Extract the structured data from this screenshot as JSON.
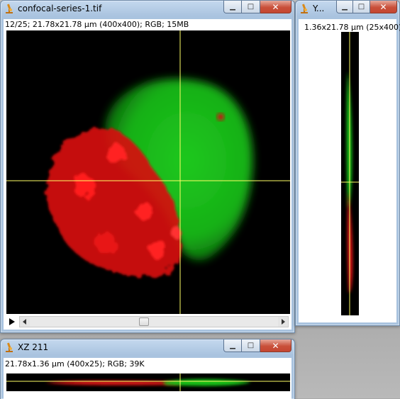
{
  "main_window": {
    "title": "confocal-series-1.tif",
    "info": "12/25; 21.78x21.78 µm (400x400); RGB; 15MB",
    "slice_current": 12,
    "slice_total": 25
  },
  "yz_window": {
    "title": "Y...",
    "info": "1.36x21.78 µm (25x400)"
  },
  "xz_window": {
    "title": "XZ 211",
    "info": "21.78x1.36 µm (400x25); RGB; 39K"
  },
  "colors": {
    "green_channel": "#00ff00",
    "red_channel": "#ff0000",
    "crosshair": "#ffff66",
    "title_bar": "#a9c3df",
    "close_button": "#c9503a"
  },
  "icons": {
    "app": "microscope-icon",
    "minimize": "minimize-icon",
    "maximize": "maximize-icon",
    "close": "close-icon",
    "play": "play-icon"
  }
}
